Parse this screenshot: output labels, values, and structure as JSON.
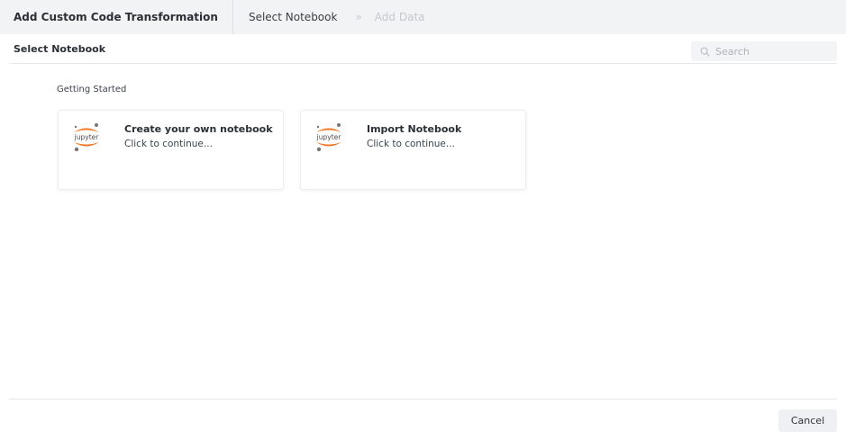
{
  "header": {
    "title": "Add Custom Code Transformation",
    "steps": [
      {
        "label": "Select Notebook",
        "state": "active"
      },
      {
        "label": "Add Data",
        "state": "disabled"
      }
    ],
    "step_separator": "»"
  },
  "subheader": {
    "label": "Select Notebook",
    "search": {
      "placeholder": "Search",
      "value": "",
      "icon": "search-icon"
    }
  },
  "section": {
    "title": "Getting Started",
    "cards": [
      {
        "title": "Create your own notebook",
        "subtitle": "Click to continue...",
        "icon": "jupyter-logo-icon",
        "logo_text": "jupyter"
      },
      {
        "title": "Import Notebook",
        "subtitle": "Click to continue...",
        "icon": "jupyter-logo-icon",
        "logo_text": "jupyter"
      }
    ]
  },
  "footer": {
    "cancel_label": "Cancel"
  },
  "colors": {
    "header_bg": "#f2f3f5",
    "jupyter_orange": "#f37626",
    "jupyter_gray": "#767677"
  }
}
